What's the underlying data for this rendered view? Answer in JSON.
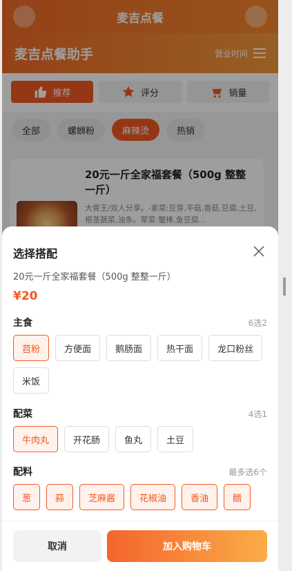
{
  "topbar": {
    "title": "麦吉点餐"
  },
  "header": {
    "brand": "麦吉点餐助手",
    "hours_label": "营业时间"
  },
  "sort_tabs": [
    {
      "label": "推荐",
      "icon": "thumbs-up-icon",
      "active": true
    },
    {
      "label": "评分",
      "icon": "star-icon",
      "active": false
    },
    {
      "label": "销量",
      "icon": "cart-icon",
      "active": false
    }
  ],
  "categories": [
    {
      "label": "全部",
      "active": false
    },
    {
      "label": "螺蛳粉",
      "active": false
    },
    {
      "label": "麻辣烫",
      "active": true
    },
    {
      "label": "热销",
      "active": false
    }
  ],
  "product_card": {
    "name": "20元一斤全家福套餐（500g 整整一斤）",
    "description": "大胃王/双人分享。-素菜:豆芽,平菇,香菇,豆腐,土豆,根茎蔬菜,油条。荤菜:蟹棒,鱼豆腐…"
  },
  "sheet": {
    "title": "选择搭配",
    "product_name": "20元一斤全家福套餐（500g 整整一斤）",
    "price": "¥20",
    "groups": [
      {
        "label": "主食",
        "rule": "6选2",
        "options": [
          {
            "label": "苕粉",
            "selected": true
          },
          {
            "label": "方便面",
            "selected": false
          },
          {
            "label": "鹅肠面",
            "selected": false
          },
          {
            "label": "热干面",
            "selected": false
          },
          {
            "label": "龙口粉丝",
            "selected": false
          },
          {
            "label": "米饭",
            "selected": false
          }
        ]
      },
      {
        "label": "配菜",
        "rule": "4选1",
        "options": [
          {
            "label": "牛肉丸",
            "selected": true
          },
          {
            "label": "开花肠",
            "selected": false
          },
          {
            "label": "鱼丸",
            "selected": false
          },
          {
            "label": "土豆",
            "selected": false
          }
        ]
      },
      {
        "label": "配料",
        "rule": "最多选6个",
        "options": [
          {
            "label": "葱",
            "selected": true
          },
          {
            "label": "蒜",
            "selected": true
          },
          {
            "label": "芝麻酱",
            "selected": true
          },
          {
            "label": "花椒油",
            "selected": true
          },
          {
            "label": "香油",
            "selected": true
          },
          {
            "label": "醋",
            "selected": true
          }
        ]
      }
    ],
    "cancel_label": "取消",
    "add_label": "加入购物车"
  },
  "colors": {
    "accent": "#f05a22",
    "accent_light": "#fff1eb"
  }
}
